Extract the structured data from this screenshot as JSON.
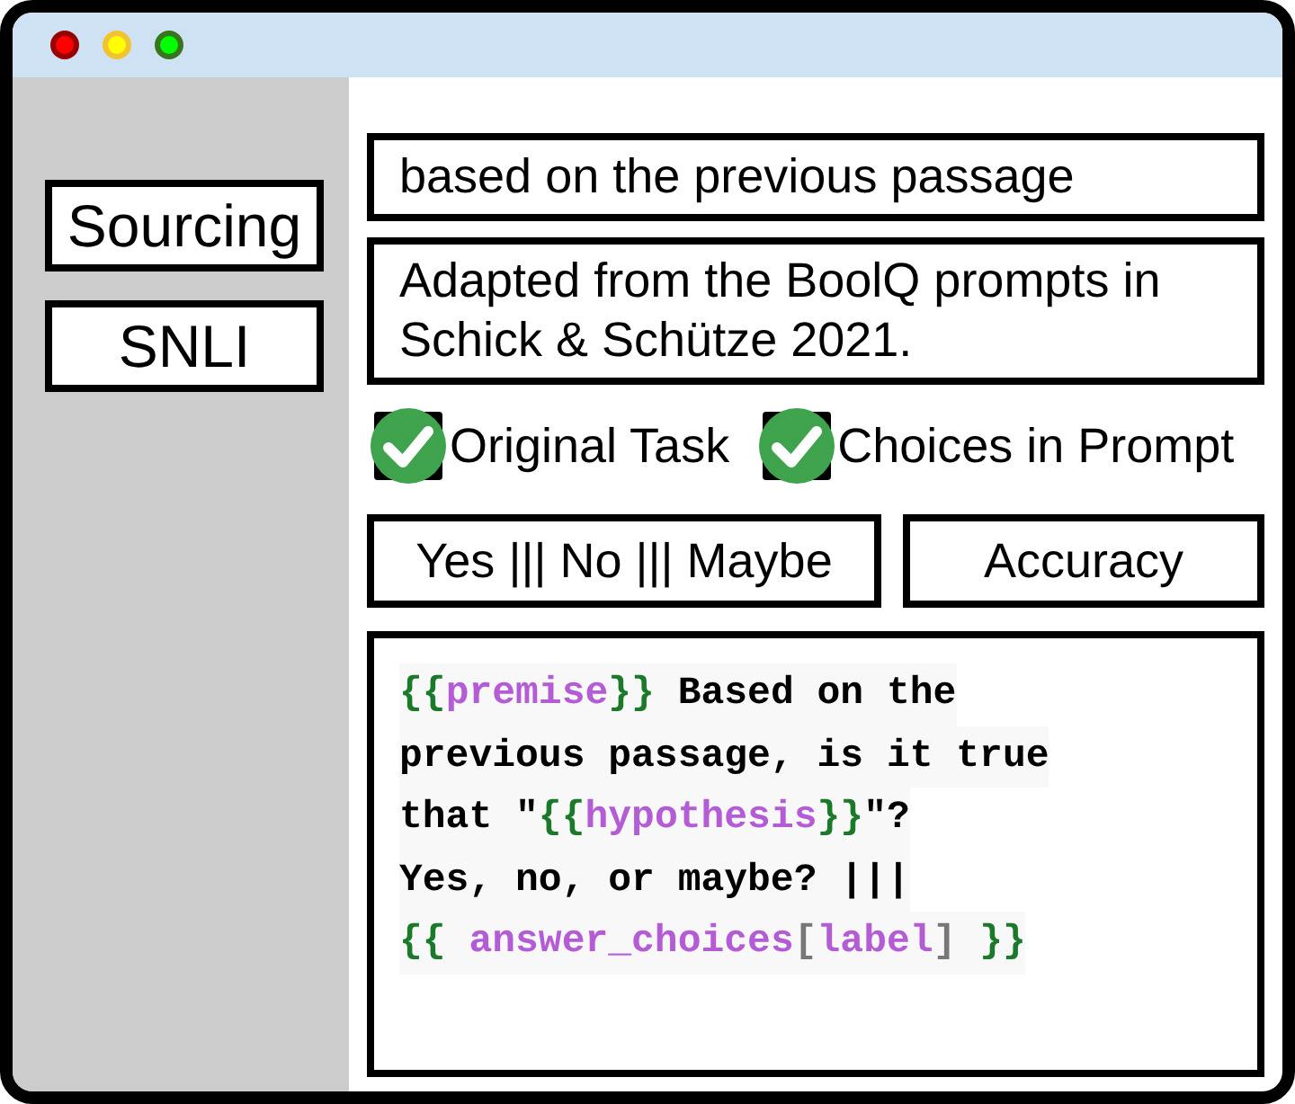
{
  "sidebar": {
    "items": [
      {
        "label": "Sourcing"
      },
      {
        "label": "SNLI"
      }
    ]
  },
  "main": {
    "answer_name": "based on the previous passage",
    "note": "Adapted from the BoolQ prompts in Schick & Schütze 2021.",
    "checks": [
      {
        "label": "Original Task",
        "checked": true
      },
      {
        "label": "Choices in Prompt",
        "checked": true
      }
    ],
    "choices": "Yes ||| No ||| Maybe",
    "metric": "Accuracy",
    "template": [
      [
        {
          "kind": "brace",
          "text": "{{"
        },
        {
          "kind": "var",
          "text": "premise"
        },
        {
          "kind": "brace",
          "text": "}}"
        },
        {
          "kind": "text",
          "text": " Based on the"
        }
      ],
      [
        {
          "kind": "text",
          "text": "previous passage, is it true"
        }
      ],
      [
        {
          "kind": "text",
          "text": "that \""
        },
        {
          "kind": "brace",
          "text": "{{"
        },
        {
          "kind": "var",
          "text": "hypothesis"
        },
        {
          "kind": "brace",
          "text": "}}"
        },
        {
          "kind": "text",
          "text": "\"?"
        }
      ],
      [
        {
          "kind": "text",
          "text": "Yes, no, or maybe? |||"
        }
      ],
      [
        {
          "kind": "brace",
          "text": "{{ "
        },
        {
          "kind": "var",
          "text": "answer_choices"
        },
        {
          "kind": "bracket",
          "text": "["
        },
        {
          "kind": "var",
          "text": "label"
        },
        {
          "kind": "bracket",
          "text": "]"
        },
        {
          "kind": "brace",
          "text": " }}"
        }
      ]
    ]
  }
}
